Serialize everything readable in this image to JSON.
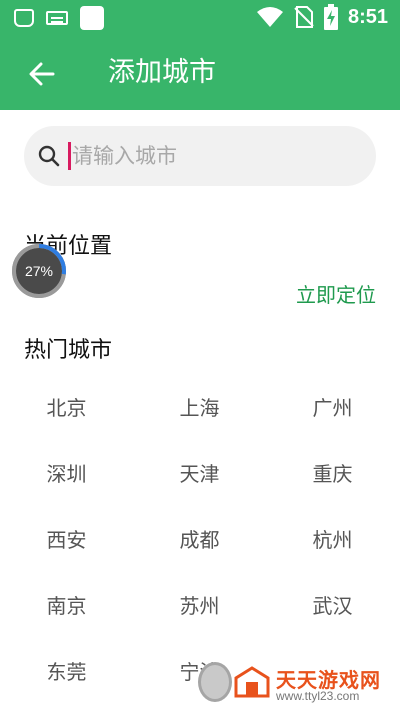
{
  "status_bar": {
    "time": "8:51",
    "icons": [
      "moto-icon",
      "keyboard-icon",
      "app-square-icon",
      "wifi-icon",
      "no-sim-icon",
      "battery-charging-icon"
    ]
  },
  "app_bar": {
    "title": "添加城市",
    "back_icon": "arrow-left-icon"
  },
  "search": {
    "placeholder": "请输入城市",
    "value": ""
  },
  "current_location": {
    "title": "当前位置",
    "locate_label": "立即定位"
  },
  "progress_badge": {
    "text": "27%",
    "value": 0.27
  },
  "hot_cities": {
    "title": "热门城市",
    "items": [
      "北京",
      "上海",
      "广州",
      "深圳",
      "天津",
      "重庆",
      "西安",
      "成都",
      "杭州",
      "南京",
      "苏州",
      "武汉",
      "东莞",
      "宁波"
    ]
  },
  "watermark": {
    "title": "天天游戏网",
    "url": "www.ttyl23.com"
  },
  "colors": {
    "primary": "#38b56a",
    "accent_text": "#1f9a4e",
    "cursor": "#d81b60",
    "watermark": "#e8521c"
  }
}
